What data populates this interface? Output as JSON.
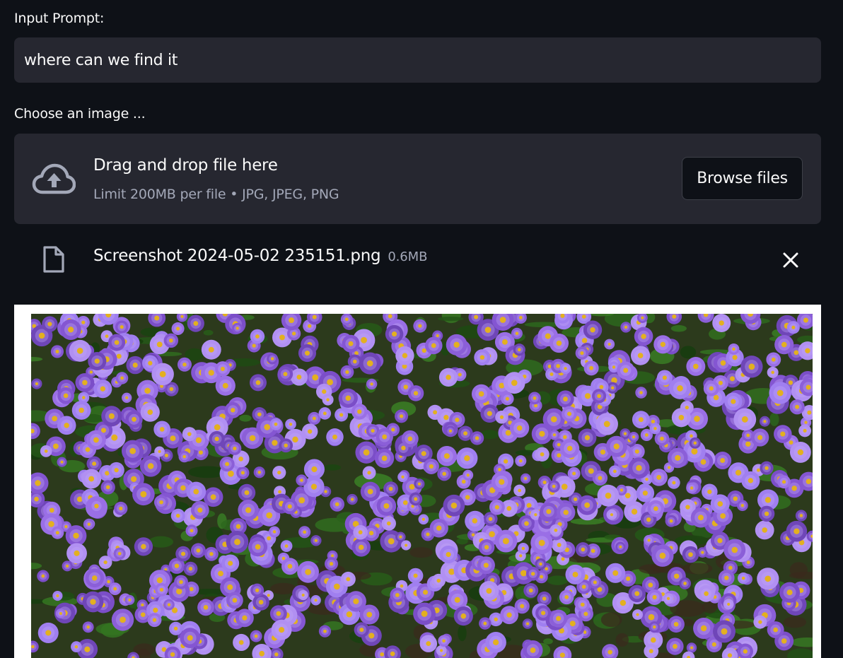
{
  "prompt": {
    "label": "Input Prompt:",
    "value": "where can we find it"
  },
  "uploader": {
    "label": "Choose an image ...",
    "title": "Drag and drop file here",
    "subtitle": "Limit 200MB per file • JPG, JPEG, PNG",
    "browse_label": "Browse files",
    "icon": "cloud-upload-icon"
  },
  "file": {
    "name": "Screenshot 2024-05-02 235151.png",
    "size": "0.6MB",
    "icon": "file-icon",
    "remove_icon": "close-icon"
  },
  "image": {
    "subject": "purple aster flowers"
  },
  "colors": {
    "background": "#0e1117",
    "surface": "#262730",
    "text": "#fafafa",
    "muted": "#a3a8b8"
  }
}
